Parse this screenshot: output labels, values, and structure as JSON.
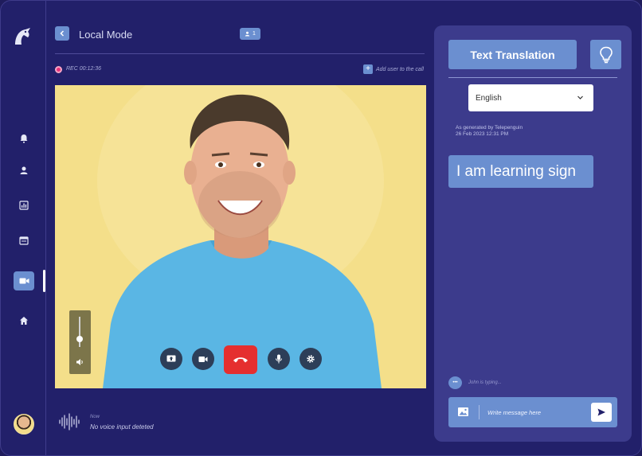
{
  "header": {
    "title": "Local Mode",
    "participants_count": "1",
    "rec_label": "REC",
    "rec_time": "00:12:36",
    "add_user_label": "Add user to the call"
  },
  "sidebar": {
    "items": [
      {
        "icon": "bell-icon"
      },
      {
        "icon": "user-icon"
      },
      {
        "icon": "chart-icon"
      },
      {
        "icon": "calendar-icon"
      },
      {
        "icon": "video-icon",
        "active": true
      },
      {
        "icon": "home-icon"
      }
    ]
  },
  "call_controls": [
    "share-screen-icon",
    "camera-icon",
    "end-call-icon",
    "microphone-icon",
    "settings-icon"
  ],
  "voice": {
    "label": "Now",
    "status": "No voice input deteted"
  },
  "panel": {
    "text_translation_label": "Text Translation",
    "language": "English",
    "generated_by": "As generated by Telepenguin",
    "generated_at": "26 Feb 2023 12:31 PM",
    "translation_text": "I am learning sign",
    "typing_indicator": "John is typing...",
    "message_placeholder": "Write message here"
  },
  "colors": {
    "background": "#22206a",
    "panel": "#3c3b8c",
    "accent": "#6b8fd0",
    "end_call": "#e52f2f",
    "rec": "#e8327a"
  }
}
